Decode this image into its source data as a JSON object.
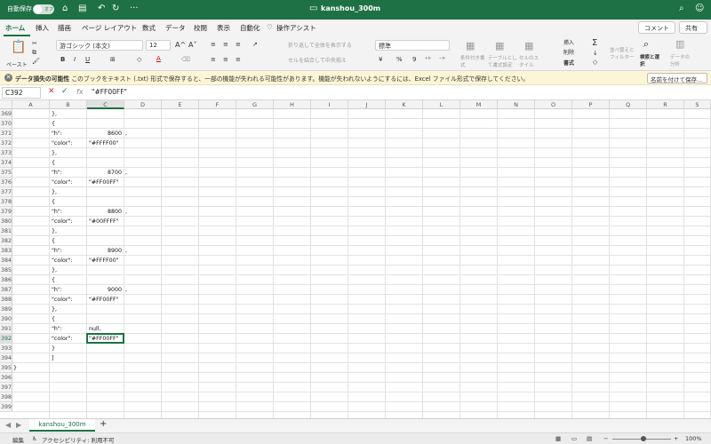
{
  "titlebar": {
    "autosave_label": "自動保存",
    "autosave_state": "オフ",
    "document_title": "kanshou_300m",
    "home_icon": "home-icon",
    "save_icon": "save-icon",
    "undo_icon": "undo-icon",
    "more_label": "···"
  },
  "tabs": [
    {
      "label": "ホーム",
      "active": true
    },
    {
      "label": "挿入"
    },
    {
      "label": "描画"
    },
    {
      "label": "ページ レイアウト"
    },
    {
      "label": "数式"
    },
    {
      "label": "データ"
    },
    {
      "label": "校閲"
    },
    {
      "label": "表示"
    },
    {
      "label": "自動化"
    },
    {
      "label": "操作アシスト"
    }
  ],
  "ribbon_actions": {
    "comment_label": "コメント",
    "share_label": "共有"
  },
  "ribbon": {
    "paste_label": "ペースト",
    "font_name": "游ゴシック (本文)",
    "font_size": "12",
    "grow_font": "A^",
    "shrink_font": "A˅",
    "bold": "B",
    "italic": "I",
    "underline": "U",
    "font_color_glyph": "A",
    "wrap_text": "折り返して全体を表示する",
    "merge_center": "セルを結合して中央揃え",
    "number_format": "標準",
    "percent": "%",
    "comma": "9",
    "conditional_format": "条件付き書式",
    "format_as_table": "テーブルとして書式設定",
    "cell_styles": "セルのスタイル",
    "insert": "挿入",
    "delete": "削除",
    "format": "書式",
    "sum_glyph": "Σ",
    "sort_filter": "並べ替えとフィルター",
    "find_select": "検索と選択",
    "analyze_data": "データの分析"
  },
  "message_bar": {
    "title": "データ損失の可能性",
    "text": "このブックをテキスト (.txt) 形式で保存すると、一部の機能が失われる可能性があります。機能が失われないようにするには、Excel ファイル形式で保存してください。",
    "button_label": "名前を付けて保存..."
  },
  "formula_bar": {
    "name_box": "C392",
    "formula": "\"#FF00FF\"",
    "fx_label": "fx"
  },
  "columns": [
    "A",
    "B",
    "C",
    "D",
    "E",
    "F",
    "G",
    "H",
    "I",
    "J",
    "K",
    "L",
    "M",
    "N",
    "O",
    "P",
    "Q",
    "R",
    "S"
  ],
  "selected_column": "C",
  "rows": [
    {
      "n": "369",
      "b": "},",
      "c": "",
      "d": ""
    },
    {
      "n": "370",
      "b": "{",
      "c": "",
      "d": ""
    },
    {
      "n": "371",
      "b": "\"h\":",
      "c": "8600",
      "d": ","
    },
    {
      "n": "372",
      "b": "\"color\":",
      "c": "\"#FFFF00\"",
      "d": ""
    },
    {
      "n": "373",
      "b": "},",
      "c": "",
      "d": ""
    },
    {
      "n": "374",
      "b": "{",
      "c": "",
      "d": ""
    },
    {
      "n": "375",
      "b": "\"h\":",
      "c": "8700",
      "d": ","
    },
    {
      "n": "376",
      "b": "\"color\":",
      "c": "\"#FF00FF\"",
      "d": ""
    },
    {
      "n": "377",
      "b": "},",
      "c": "",
      "d": ""
    },
    {
      "n": "378",
      "b": "{",
      "c": "",
      "d": ""
    },
    {
      "n": "379",
      "b": "\"h\":",
      "c": "8800",
      "d": ","
    },
    {
      "n": "380",
      "b": "\"color\":",
      "c": "\"#00FFFF\"",
      "d": ""
    },
    {
      "n": "381",
      "b": "},",
      "c": "",
      "d": ""
    },
    {
      "n": "382",
      "b": "{",
      "c": "",
      "d": ""
    },
    {
      "n": "383",
      "b": "\"h\":",
      "c": "8900",
      "d": ","
    },
    {
      "n": "384",
      "b": "\"color\":",
      "c": "\"#FFFF00\"",
      "d": ""
    },
    {
      "n": "385",
      "b": "},",
      "c": "",
      "d": ""
    },
    {
      "n": "386",
      "b": "{",
      "c": "",
      "d": ""
    },
    {
      "n": "387",
      "b": "\"h\":",
      "c": "9000",
      "d": ","
    },
    {
      "n": "388",
      "b": "\"color\":",
      "c": "\"#FF00FF\"",
      "d": ""
    },
    {
      "n": "389",
      "b": "},",
      "c": "",
      "d": ""
    },
    {
      "n": "390",
      "b": "{",
      "c": "",
      "d": ""
    },
    {
      "n": "391",
      "b": "\"h\":",
      "c": "null,",
      "d": ""
    },
    {
      "n": "392",
      "b": "\"color\":",
      "c": "\"#FF00FF\"",
      "d": ""
    },
    {
      "n": "393",
      "b": "}",
      "c": "",
      "d": ""
    },
    {
      "n": "394",
      "b": "]",
      "c": "",
      "d": ""
    },
    {
      "n": "395",
      "a": "}",
      "b": "",
      "c": "",
      "d": ""
    },
    {
      "n": "396",
      "b": "",
      "c": "",
      "d": ""
    },
    {
      "n": "397",
      "b": "",
      "c": "",
      "d": ""
    },
    {
      "n": "398",
      "b": "",
      "c": "",
      "d": ""
    },
    {
      "n": "399",
      "b": "",
      "c": "",
      "d": ""
    }
  ],
  "selected_row": "392",
  "sheet_tabs": [
    {
      "label": "kanshou_300m",
      "active": true
    }
  ],
  "add_sheet_label": "+",
  "status_bar": {
    "mode": "編集",
    "accessibility": "アクセシビリティ: 利用不可",
    "zoom": "100%"
  },
  "colors": {
    "brand": "#1e7145",
    "message_bar_bg": "#fdf6d6"
  }
}
